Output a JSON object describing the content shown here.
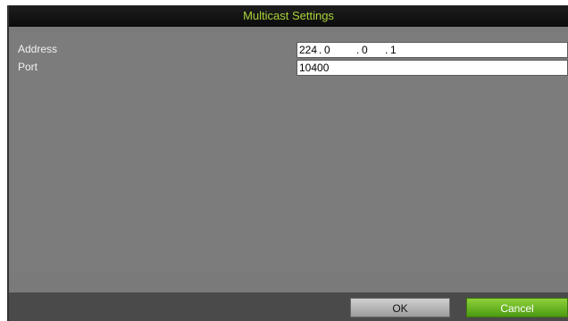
{
  "dialog": {
    "title": "Multicast Settings"
  },
  "fields": {
    "address": {
      "label": "Address",
      "octets": [
        "224",
        "0",
        "0",
        "1"
      ]
    },
    "port": {
      "label": "Port",
      "value": "10400"
    }
  },
  "buttons": {
    "ok": "OK",
    "cancel": "Cancel"
  },
  "colors": {
    "title_text": "#a8d23a",
    "accent_button": "#6cb826",
    "panel_bg": "#7c7c7c"
  }
}
